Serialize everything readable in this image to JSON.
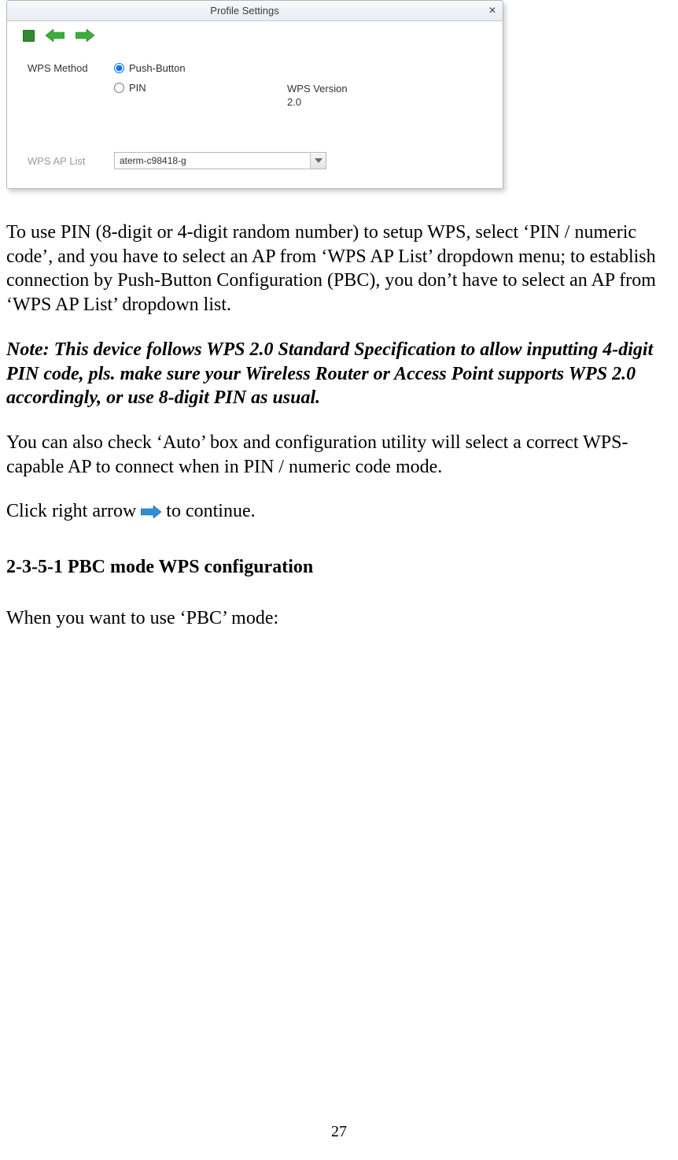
{
  "dialog": {
    "title": "Profile Settings",
    "wps_method_label": "WPS Method",
    "opt_push_button": "Push-Button",
    "opt_pin": "PIN",
    "wps_version_label": "WPS Version",
    "wps_version_value": "2.0",
    "ap_list_label": "WPS AP List",
    "ap_list_value": "aterm-c98418-g"
  },
  "text": {
    "p1": "To use PIN (8-digit or 4-digit random number) to setup WPS, select ‘PIN / numeric code’, and you have to select an AP from ‘WPS AP List’ dropdown menu; to establish connection by Push-Button Configuration (PBC), you don’t have to select an AP from ‘WPS AP List’ dropdown list.",
    "note": "Note: This device follows WPS 2.0 Standard Specification to allow inputting 4-digit PIN code, pls. make sure your Wireless Router or Access Point supports WPS 2.0 accordingly, or use 8-digit PIN as usual.",
    "p2": "You can also check ‘Auto’ box and configuration utility will select a correct WPS-capable AP to connect when in PIN / numeric code mode.",
    "click_prefix": "Click right arrow",
    "click_suffix": "to continue.",
    "heading": "2-3-5-1 PBC mode WPS configuration",
    "p3": "When you want to use ‘PBC’ mode:"
  },
  "page_number": "27",
  "colors": {
    "arrow_green": "#2f9e2f"
  }
}
